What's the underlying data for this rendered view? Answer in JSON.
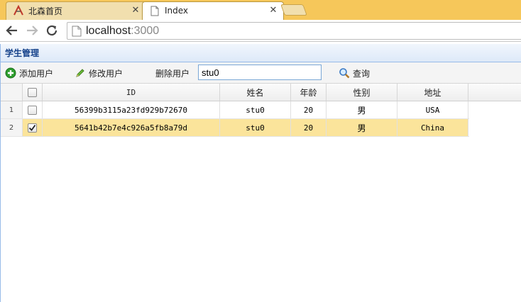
{
  "browser": {
    "tabs": [
      {
        "title": "北森首页",
        "active": false
      },
      {
        "title": "Index",
        "active": true
      }
    ],
    "url_host": "localhost",
    "url_port": ":3000"
  },
  "panel": {
    "title": "学生管理"
  },
  "toolbar": {
    "add_label": "添加用户",
    "edit_label": "修改用户",
    "delete_label": "删除用户",
    "search_value": "stu0",
    "query_label": "查询"
  },
  "grid": {
    "columns": [
      "ID",
      "姓名",
      "年龄",
      "性别",
      "地址"
    ],
    "rows": [
      {
        "num": "1",
        "checked": false,
        "id": "56399b3115a23fd929b72670",
        "name": "stu0",
        "age": "20",
        "sex": "男",
        "addr": "USA"
      },
      {
        "num": "2",
        "checked": true,
        "id": "5641b42b7e4c926a5fb8a79d",
        "name": "stu0",
        "age": "20",
        "sex": "男",
        "addr": "China"
      }
    ]
  },
  "colors": {
    "tabstrip": "#f6c75a",
    "panel_title": "#15428b",
    "selected_row": "#fbe49b",
    "add_icon": "#2e9e2e"
  }
}
